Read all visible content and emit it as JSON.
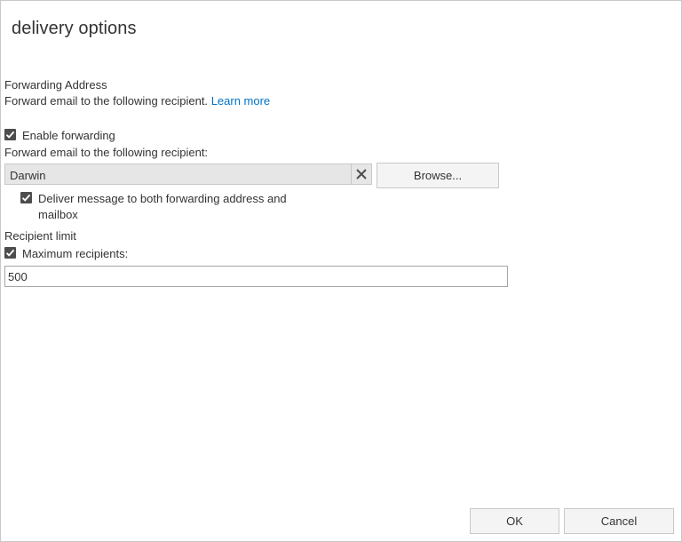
{
  "window": {
    "title": "delivery options"
  },
  "forwarding": {
    "section_title": "Forwarding Address",
    "description": "Forward email to the following recipient.",
    "learn_more": "Learn more",
    "enable_label": "Enable forwarding",
    "enable_checked": true,
    "recipient_label": "Forward email to the following recipient:",
    "recipient_value": "Darwin",
    "browse_label": "Browse...",
    "deliver_both_line1": "Deliver message to both forwarding address and",
    "deliver_both_line2": "mailbox",
    "deliver_both_checked": true
  },
  "recipient_limit": {
    "section_title": "Recipient limit",
    "max_label": "Maximum recipients:",
    "max_checked": true,
    "max_value": "500"
  },
  "footer": {
    "ok_label": "OK",
    "cancel_label": "Cancel"
  },
  "icons": {
    "checkbox": "checkmark-icon",
    "clear": "close-icon"
  },
  "colors": {
    "link": "#0072c6",
    "checkbox": "#4d4d4d",
    "field_bg": "#e6e6e6"
  }
}
